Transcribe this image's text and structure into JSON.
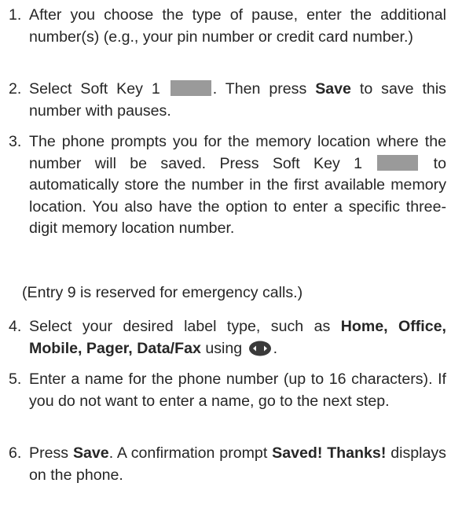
{
  "steps": [
    {
      "number": "1.",
      "text": "After you choose the type of pause, enter the additional number(s) (e.g., your pin number or credit card number.)"
    },
    {
      "number": "2.",
      "text_a": "Select Soft Key 1",
      "text_b": ". Then press",
      "bold_save": "Save",
      "text_c": "to save this number with pauses."
    },
    {
      "number": "3.",
      "text_a": "The phone prompts you for the memory location where the number will be saved. Press Soft Key 1",
      "text_b": "to automatically store the number in the first available memory location. You also have the option to enter a specific three-digit memory location number."
    },
    {
      "number": "4.",
      "text_a": "Select your desired label type, such as",
      "bold_labels": "Home, Office, Mobile, Pager, Data/Fax",
      "text_b": "using",
      "text_c": "."
    },
    {
      "number": "5.",
      "text": "Enter a name for the phone number (up to 16 characters). If you do not want to enter a name, go to the next step."
    },
    {
      "number": "6.",
      "text_a": "Press",
      "bold_save": "Save",
      "text_b": ". A confirmation prompt",
      "bold_prompt": "Saved! Thanks!",
      "text_c": "displays on the phone."
    }
  ],
  "note": "(Entry 9 is reserved for emergency calls.)",
  "icons": {
    "soft_key": "soft-key-1-graphic",
    "navigation": "navigation-key-icon"
  },
  "colors": {
    "text": "#262626",
    "soft_key_fill": "#9a9a9a",
    "nav_icon_fill": "#3a3a3a"
  }
}
